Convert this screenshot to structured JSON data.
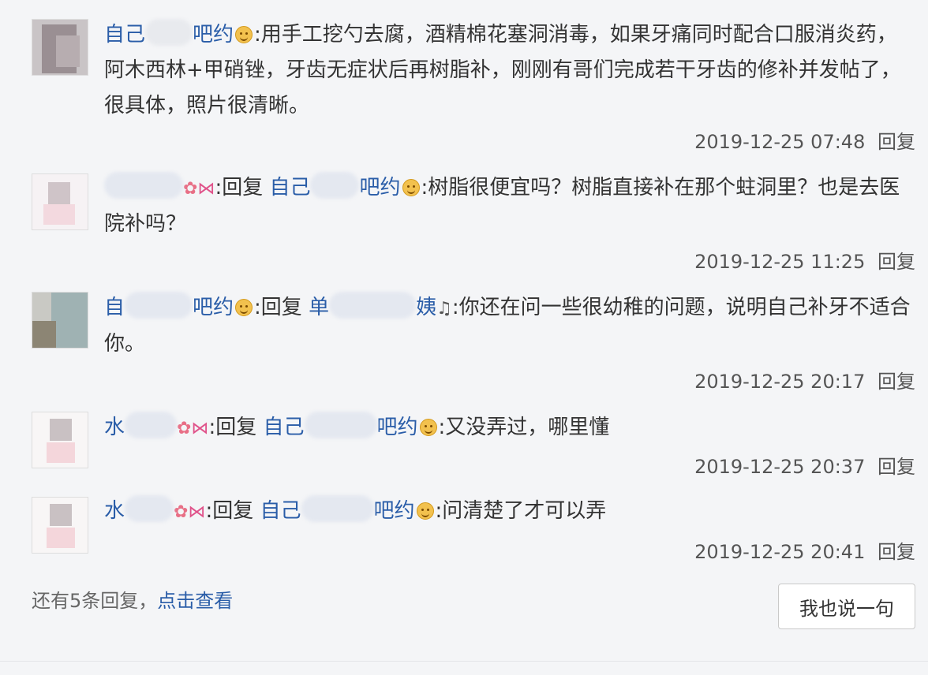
{
  "replies": [
    {
      "user": {
        "prefix": "自己",
        "suffix": "吧约"
      },
      "reply_word": "",
      "target": null,
      "text": ":用手工挖勺去腐，酒精棉花塞洞消毒，如果牙痛同时配合口服消炎药，阿木西林+甲硝锉，牙齿无症状后再树脂补，刚刚有哥们完成若干牙齿的修补并发帖了，很具体，照片很清晰。",
      "time": "2019-12-25 07:48",
      "reply_label": "回复"
    },
    {
      "user": {
        "prefix": "",
        "suffix": ""
      },
      "reply_word": ":回复",
      "target": {
        "prefix": "自己",
        "suffix": "吧约"
      },
      "text": ":树脂很便宜吗？树脂直接补在那个蛀洞里？也是去医院补吗？",
      "time": "2019-12-25 11:25",
      "reply_label": "回复"
    },
    {
      "user": {
        "prefix": "自",
        "suffix": "吧约"
      },
      "reply_word": ":回复",
      "target": {
        "prefix": "单",
        "suffix": "姨"
      },
      "text": ":你还在问一些很幼稚的问题，说明自己补牙不适合你。",
      "time": "2019-12-25 20:17",
      "reply_label": "回复"
    },
    {
      "user": {
        "prefix": "水",
        "suffix": ""
      },
      "reply_word": ":回复",
      "target": {
        "prefix": "自己",
        "suffix": "吧约"
      },
      "text": ":又没弄过，哪里懂",
      "time": "2019-12-25 20:37",
      "reply_label": "回复"
    },
    {
      "user": {
        "prefix": "水",
        "suffix": ""
      },
      "reply_word": ":回复",
      "target": {
        "prefix": "自己",
        "suffix": "吧约"
      },
      "text": ":问清楚了才可以弄",
      "time": "2019-12-25 20:41",
      "reply_label": "回复"
    }
  ],
  "footer": {
    "more_text": "还有5条回复，",
    "more_link": "点击查看",
    "say_button": "我也说一句"
  },
  "colors": {
    "username": "#2a5da8",
    "background": "#f4f5f7",
    "text": "#333333"
  },
  "icons": [
    "smiley-emoji-icon",
    "flower-icon",
    "bow-icon",
    "music-note-icon"
  ]
}
